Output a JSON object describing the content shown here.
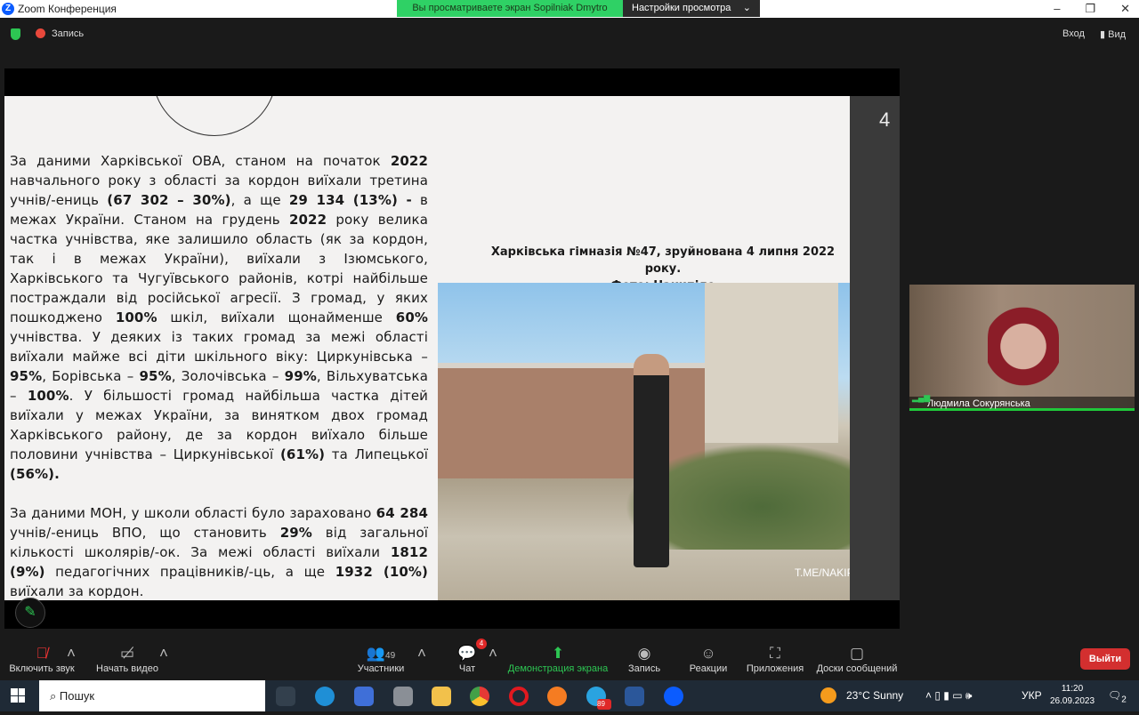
{
  "window": {
    "title": "Zoom Конференция",
    "share_banner": "Вы просматриваете экран Sopilniak Dmytro",
    "view_settings": "Настройки просмотра"
  },
  "topbar": {
    "recording": "Запись",
    "enter": "Вход",
    "view": "Вид"
  },
  "slide": {
    "number": "4",
    "caption_line1": "Харківська гімназія №47, зруйнована 4 липня 2022 року.",
    "caption_line2": "Фото: Накипіло",
    "watermark": "T.ME/NAKIPELOVO",
    "paragraphs": [
      [
        {
          "t": "За даними Харківської ОВА, станом на початок "
        },
        {
          "t": "2022",
          "b": true
        },
        {
          "t": " навчального року з області за кордон виїхали третина учнів/-ениць "
        },
        {
          "t": "(67 302 – 30%)",
          "b": true
        },
        {
          "t": ", а ще "
        },
        {
          "t": "29 134 (13%) -",
          "b": true
        },
        {
          "t": " в межах України. Станом на грудень "
        },
        {
          "t": "2022",
          "b": true
        },
        {
          "t": " року велика частка учнівства, яке залишило область (як за кордон, так і в межах України), виїхали з Ізюмського, Харківського та Чугуївського районів, котрі найбільше постраждали від російської агресії. З громад, у яких пошкоджено "
        },
        {
          "t": "100%",
          "b": true
        },
        {
          "t": " шкіл, виїхали щонайменше "
        },
        {
          "t": "60%",
          "b": true
        },
        {
          "t": " учнівства. У деяких із таких громад за межі області виїхали майже всі діти шкільного віку: Циркунівська – "
        },
        {
          "t": "95%",
          "b": true
        },
        {
          "t": ", Борівська – "
        },
        {
          "t": "95%",
          "b": true
        },
        {
          "t": ", Золочівська – "
        },
        {
          "t": "99%",
          "b": true
        },
        {
          "t": ", Вільхуватська – "
        },
        {
          "t": "100%",
          "b": true
        },
        {
          "t": ". У більшості громад найбільша частка дітей виїхали у межах України, за винятком двох громад Харківського району, де за кордон виїхало більше половини учнівства – Циркунівської "
        },
        {
          "t": "(61%)",
          "b": true
        },
        {
          "t": " та Липецької "
        },
        {
          "t": "(56%).",
          "b": true
        }
      ],
      [
        {
          "t": "За даними МОН, у школи області було зараховано "
        },
        {
          "t": "64 284",
          "b": true
        },
        {
          "t": " учнів/-ениць ВПО, що становить "
        },
        {
          "t": "29%",
          "b": true
        },
        {
          "t": " від загальної кількості школярів/-ок. За межі області виїхали "
        },
        {
          "t": "1812 (9%)",
          "b": true
        },
        {
          "t": " педагогічних працівників/-ць, а ще "
        },
        {
          "t": "1932 (10%)",
          "b": true
        },
        {
          "t": " виїхали за кордон."
        }
      ]
    ]
  },
  "participant": {
    "name": "Людмила Сокурянська"
  },
  "toolbar": {
    "mute": "Включить звук",
    "video": "Начать видео",
    "participants": "Участники",
    "participants_count": "49",
    "chat": "Чат",
    "chat_badge": "4",
    "share": "Демонстрация экрана",
    "record": "Запись",
    "reactions": "Реакции",
    "apps": "Приложения",
    "whiteboards": "Доски сообщений",
    "leave": "Выйти"
  },
  "taskbar": {
    "search": "Пошук",
    "weather": "23°C  Sunny",
    "lang": "УКР",
    "time": "11:20",
    "date": "26.09.2023",
    "notifications": "2",
    "telegram_badge": "89"
  },
  "colors": {
    "zoom_green": "#2dc653",
    "leave_red": "#d32f2f",
    "zoom_blue": "#0b5cff"
  }
}
